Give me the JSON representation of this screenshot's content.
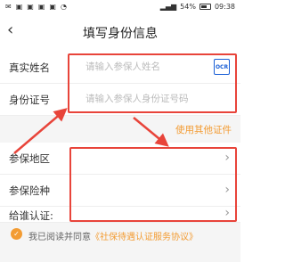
{
  "status_bar": {
    "battery": "54%",
    "time": "09:38"
  },
  "header": {
    "title": "填写身份信息"
  },
  "form": {
    "name": {
      "label": "真实姓名",
      "placeholder": "请输入参保人姓名"
    },
    "ocr_label": "OCR",
    "id": {
      "label": "身份证号",
      "placeholder": "请输入参保人身份证号码"
    },
    "other_docs": "使用其他证件",
    "region": {
      "label": "参保地区"
    },
    "insurance": {
      "label": "参保险种"
    },
    "certify_for": {
      "label": "给谁认证:"
    }
  },
  "agreement": {
    "prefix": "我已阅读并同意",
    "link": "《社保待遇认证服务协议》"
  },
  "colors": {
    "accent": "#f39c33",
    "annotation": "#e8443a",
    "ocr": "#1a5fd6"
  }
}
